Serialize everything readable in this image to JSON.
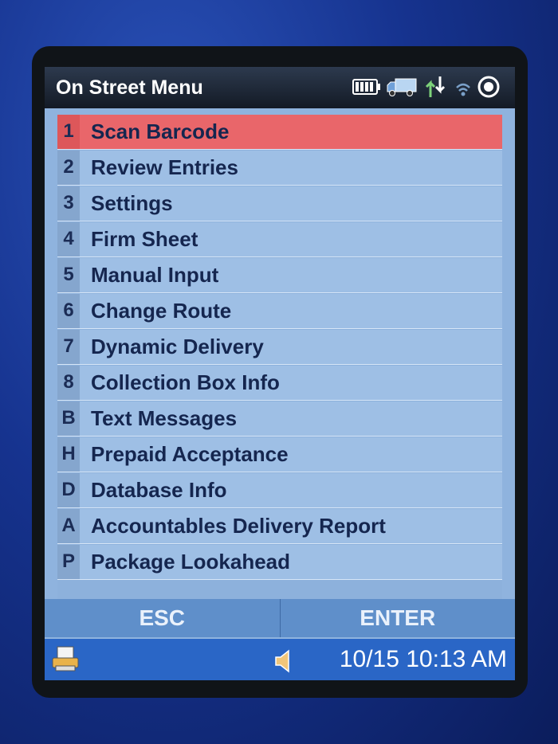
{
  "title_bar": {
    "title": "On Street Menu",
    "icons": [
      "battery-icon",
      "truck-icon",
      "sync-arrows-icon",
      "wifi-icon",
      "target-icon"
    ]
  },
  "menu": {
    "items": [
      {
        "key": "1",
        "label": "Scan Barcode",
        "selected": true
      },
      {
        "key": "2",
        "label": "Review Entries"
      },
      {
        "key": "3",
        "label": "Settings"
      },
      {
        "key": "4",
        "label": "Firm Sheet"
      },
      {
        "key": "5",
        "label": "Manual Input"
      },
      {
        "key": "6",
        "label": "Change Route"
      },
      {
        "key": "7",
        "label": "Dynamic Delivery"
      },
      {
        "key": "8",
        "label": "Collection Box Info"
      },
      {
        "key": "B",
        "label": "Text Messages"
      },
      {
        "key": "H",
        "label": "Prepaid Acceptance"
      },
      {
        "key": "D",
        "label": "Database Info"
      },
      {
        "key": "A",
        "label": "Accountables Delivery Report"
      },
      {
        "key": "P",
        "label": "Package Lookahead"
      }
    ]
  },
  "softkeys": {
    "left": "ESC",
    "right": "ENTER"
  },
  "taskbar": {
    "clock": "10/15 10:13 AM"
  },
  "colors": {
    "selected": "#e9666a",
    "menu_bg": "#9ebfe5",
    "taskbar": "#2a66c6"
  }
}
